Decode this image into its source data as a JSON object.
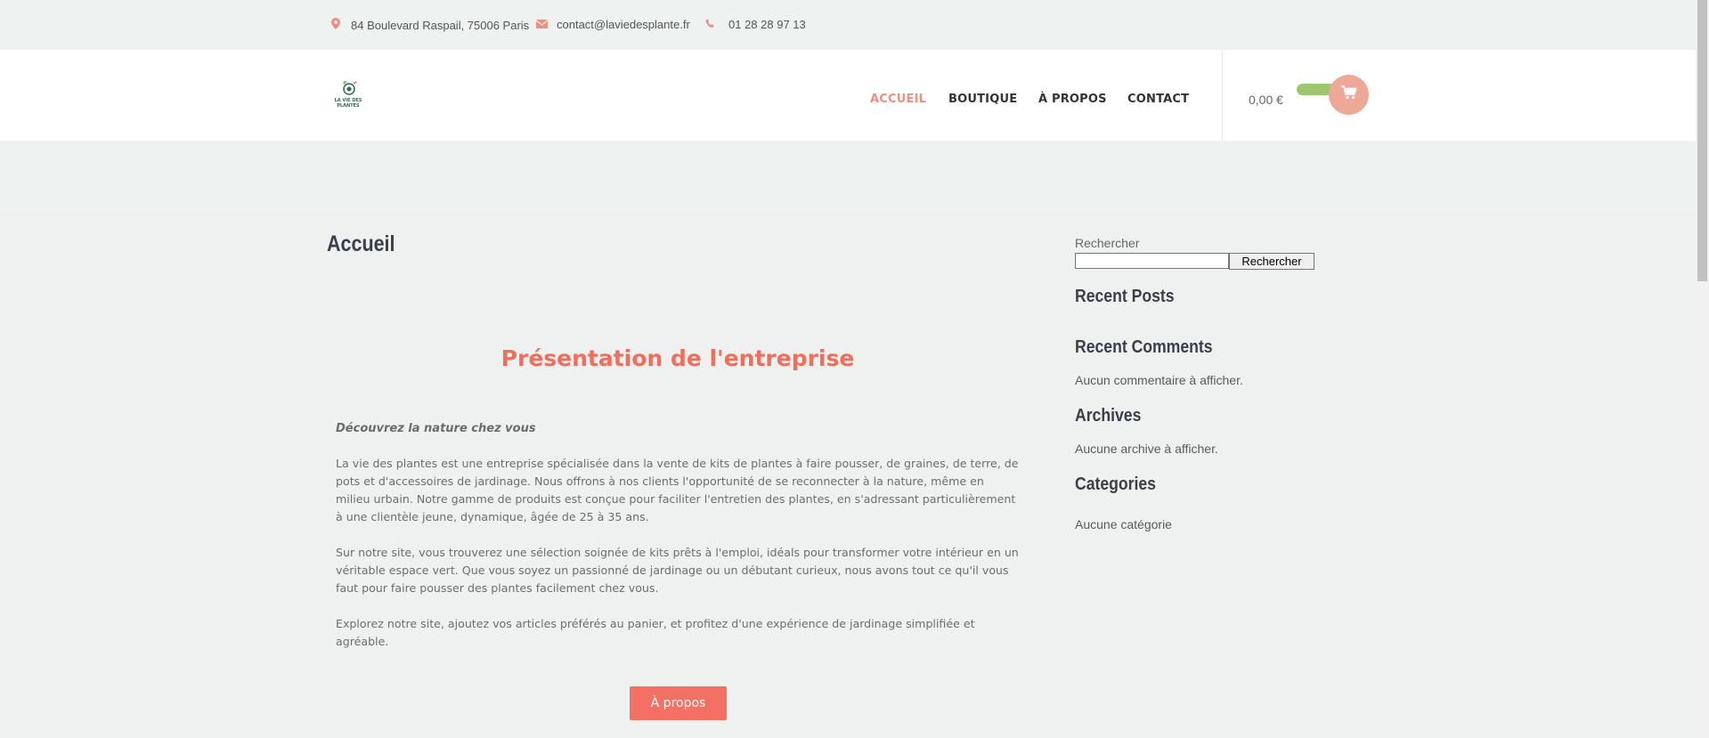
{
  "topbar": {
    "address": "84 Boulevard Raspail, 75006 Paris",
    "email": "contact@laviedesplante.fr",
    "phone": "01 28 28 97 13"
  },
  "header": {
    "logo_text": "LA VIE DES PLANTES",
    "nav": [
      "ACCUEIL",
      "BOUTIQUE",
      "À PROPOS",
      "CONTACT"
    ],
    "cart_total": "0,00 €"
  },
  "main": {
    "page_title": "Accueil",
    "section_title": "Présentation de l'entreprise",
    "lead": "Découvrez la nature chez vous",
    "paragraph_1": "La vie des plantes est une entreprise spécialisée dans la vente de kits de plantes à faire pousser, de graines, de terre, de pots et d'accessoires de jardinage. Nous offrons à nos clients l'opportunité de se reconnecter à la nature, même en milieu urbain. Notre gamme de produits est conçue pour faciliter l'entretien des plantes, en s'adressant particulièrement à une clientèle jeune, dynamique, âgée de 25 à 35 ans.",
    "paragraph_2": "Sur notre site, vous trouverez une sélection soignée de kits prêts à l'emploi, idéals pour transformer votre intérieur en un véritable espace vert. Que vous soyez un passionné de jardinage ou un débutant curieux, nous avons tout ce qu'il vous faut pour faire pousser des plantes facilement chez vous.",
    "paragraph_3": "Explorez notre site, ajoutez vos articles préférés au panier, et profitez d'une expérience de jardinage simplifiée et agréable.",
    "button_label": "À propos"
  },
  "sidebar": {
    "search_label": "Rechercher",
    "search_placeholder": "",
    "search_button": "Rechercher",
    "recent_posts_title": "Recent Posts",
    "recent_comments_title": "Recent Comments",
    "recent_comments_text": "Aucun commentaire à afficher.",
    "archives_title": "Archives",
    "archives_text": "Aucune archive à afficher.",
    "categories_title": "Categories",
    "categories_text": "Aucune catégorie"
  },
  "colors": {
    "accent": "#ef6f5e",
    "button": "#f46f64",
    "cart_circle": "#eea898",
    "cart_pill": "#9cc771",
    "background": "#eef1ef"
  },
  "icons": {
    "address": "map-pin-icon",
    "email": "envelope-icon",
    "phone": "phone-icon",
    "cart": "shopping-cart-icon"
  }
}
